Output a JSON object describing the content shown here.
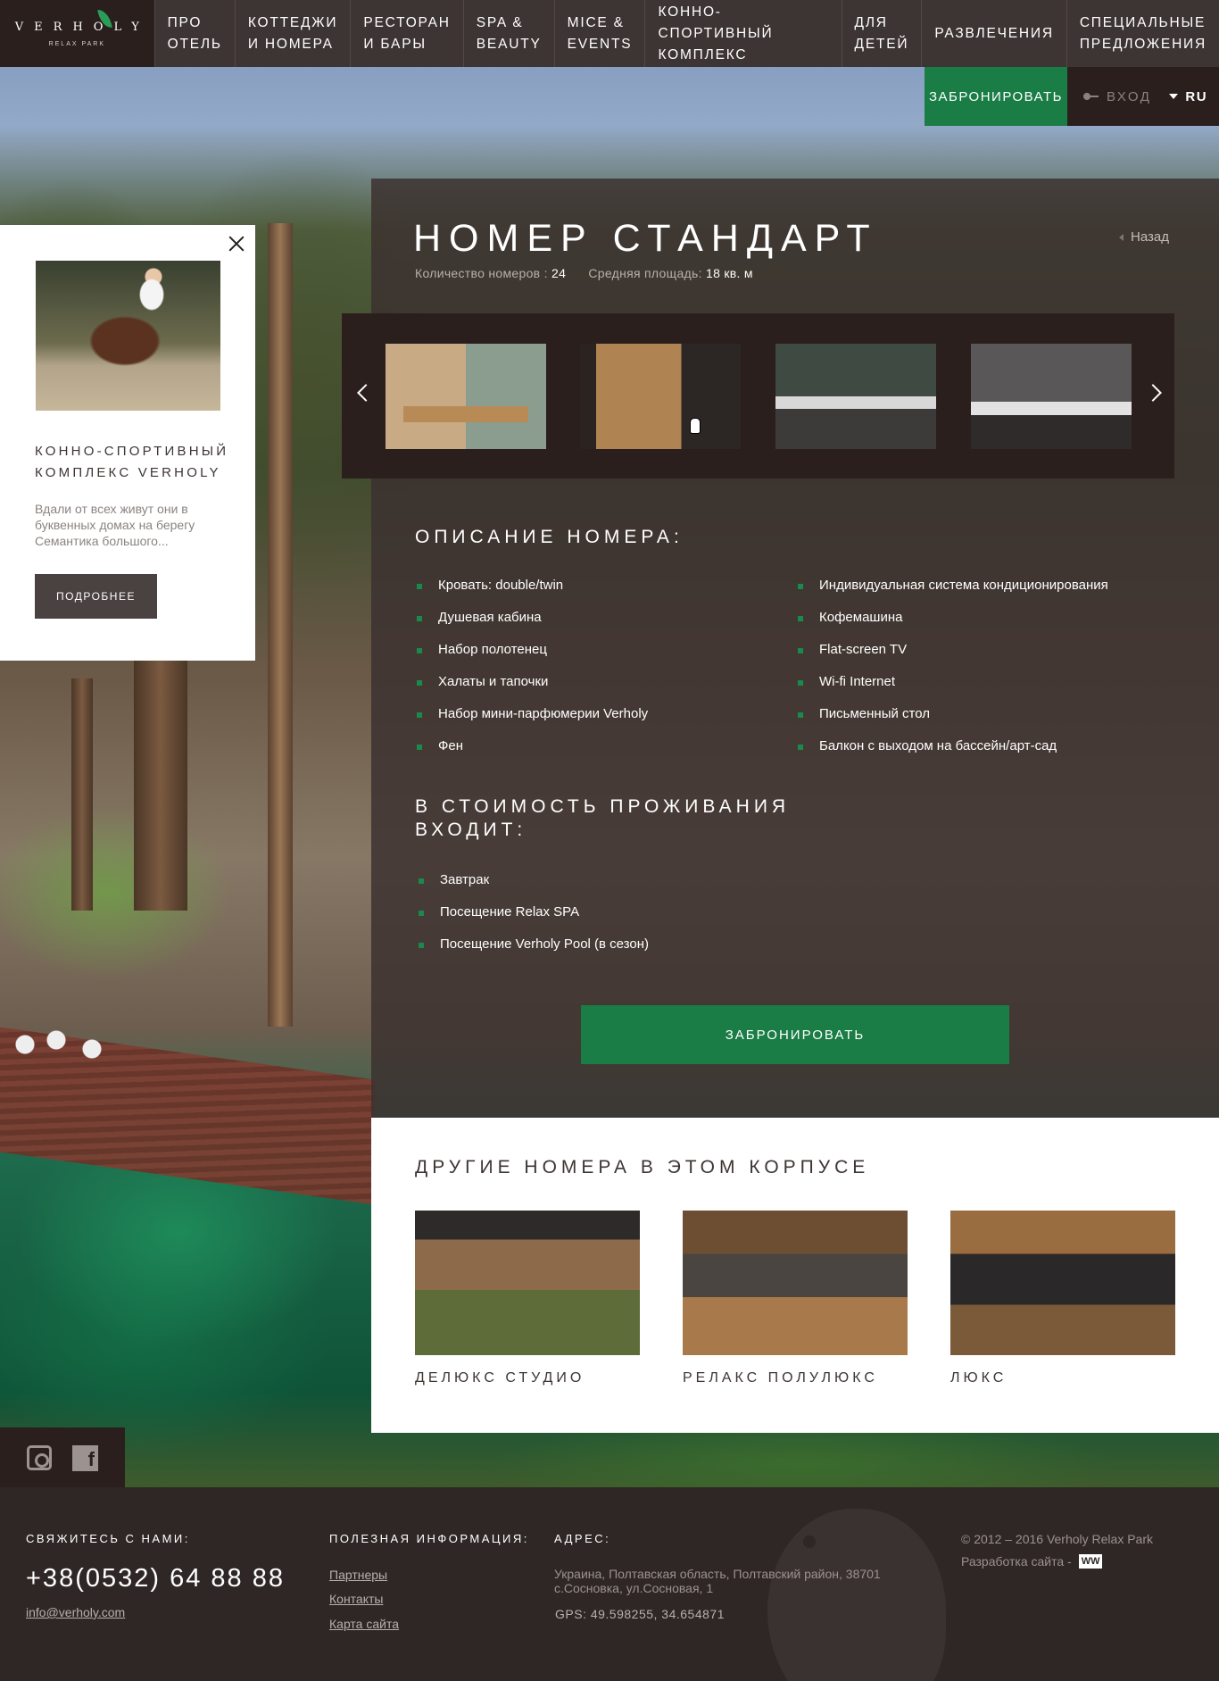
{
  "logo": {
    "name": "VERHOLY",
    "sub": "RELAX PARK"
  },
  "nav": [
    {
      "label": "ПРО\nОТЕЛЬ"
    },
    {
      "label": "КОТТЕДЖИ\nИ НОМЕРА"
    },
    {
      "label": "РЕСТОРАН\nИ БАРЫ"
    },
    {
      "label": "SPA &\nBEAUTY"
    },
    {
      "label": "MICE &\nEVENTS"
    },
    {
      "label": "КОННО-СПОРТИВНЫЙ\nКОМПЛЕКС"
    },
    {
      "label": "ДЛЯ\nДЕТЕЙ"
    },
    {
      "label": "РАЗВЛЕЧЕНИЯ"
    },
    {
      "label": "СПЕЦИАЛЬНЫЕ\nПРЕДЛОЖЕНИЯ"
    }
  ],
  "bookbar": {
    "book": "ЗАБРОНИРОВАТЬ",
    "login": "ВХОД",
    "lang": "RU"
  },
  "promo": {
    "title": "КОННО-СПОРТИВНЫЙ КОМПЛЕКС VERHOLY",
    "text": "Вдали от всех живут они в буквенных домах на берегу Семантика большого...",
    "button": "ПОДРОБНЕЕ"
  },
  "room": {
    "title": "НОМЕР СТАНДАРТ",
    "count_label": "Количество номеров :",
    "count_value": "24",
    "area_label": "Средняя площадь:",
    "area_value": "18 кв. м",
    "back": "Назад"
  },
  "description": {
    "heading": "ОПИСАНИЕ  НОМЕРА:",
    "left": [
      "Кровать: double/twin",
      "Душевая кабина",
      "Набор полотенец",
      "Халаты и тапочки",
      "Набор мини-парфюмерии Verholy",
      "Фен"
    ],
    "right": [
      "Индивидуальная система кондиционирования",
      "Кофемашина",
      "Flat-screen TV",
      "Wi-fi Internet",
      "Письменный стол",
      "Балкон с выходом на бассейн/арт-сад"
    ]
  },
  "included": {
    "heading": "В СТОИМОСТЬ ПРОЖИВАНИЯ ВХОДИТ:",
    "items": [
      "Завтрак",
      "Посещение Relax SPA",
      "Посещение Verholy Pool (в сезон)"
    ]
  },
  "book_button": "ЗАБРОНИРОВАТЬ",
  "other": {
    "heading": "ДРУГИЕ НОМЕРА В ЭТОМ КОРПУСЕ",
    "rooms": [
      "ДЕЛЮКС СТУДИО",
      "РЕЛАКС ПОЛУЛЮКС",
      "ЛЮКС"
    ]
  },
  "footer": {
    "contact_h": "СВЯЖИТЕСЬ С НАМИ:",
    "phone": "+38(0532) 64 88 88",
    "email": "info@verholy.com",
    "info_h": "ПОЛЕЗНАЯ ИНФОРМАЦИЯ:",
    "links": [
      "Партнеры",
      "Контакты",
      "Карта сайта"
    ],
    "addr_h": "АДРЕС:",
    "address": "Украина, Полтавская область, Полтавский район, 38701 с.Сосновка, ул.Сосновая, 1",
    "gps": "GPS: 49.598255, 34.654871",
    "copyright": "© 2012 – 2016  Verholy Relax Park",
    "dev": "Разработка сайта -",
    "dev_logo": "WW"
  },
  "icons": [
    "leaf-icon",
    "key-icon",
    "caret-icon",
    "close-icon",
    "arrow-left-icon",
    "arrow-right-icon",
    "back-arrow-icon",
    "instagram-icon",
    "facebook-icon",
    "bird-icon"
  ],
  "colors": {
    "accent_green": "#1a7d45",
    "dark_brown": "#2a1f1c",
    "nav_bg": "#3d3533"
  }
}
